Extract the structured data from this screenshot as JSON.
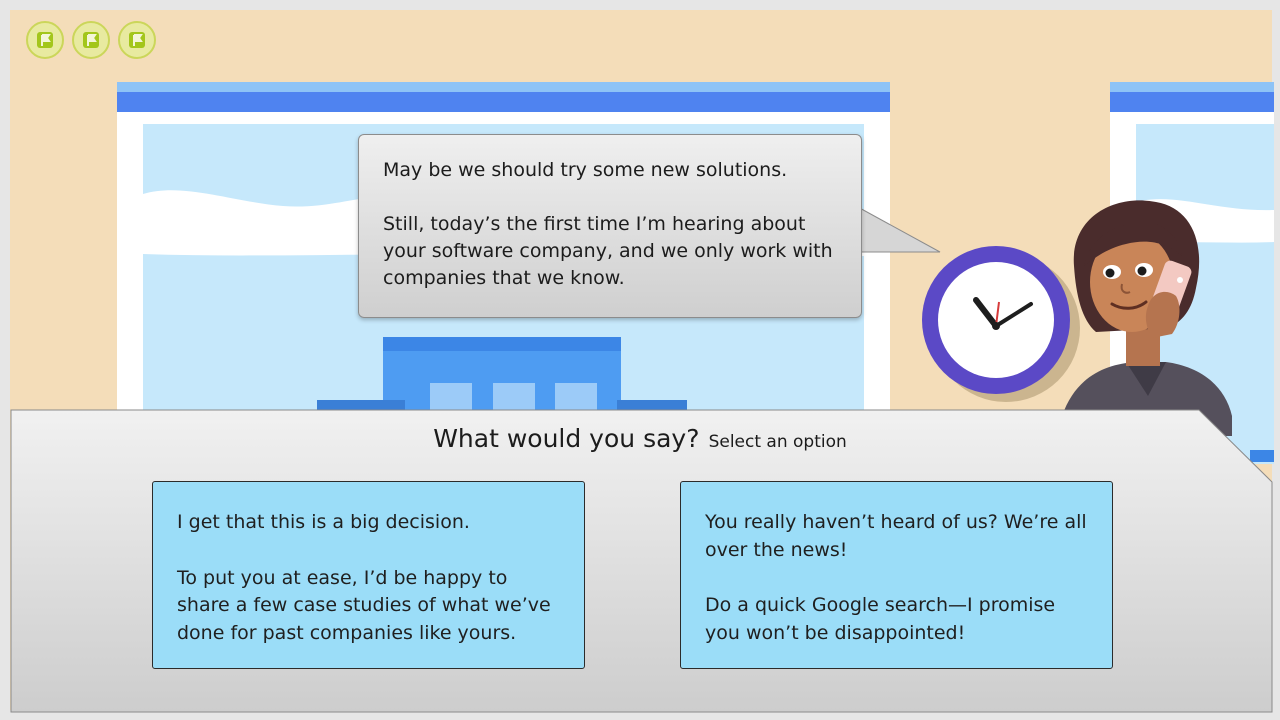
{
  "nav": {
    "flag_buttons": [
      "flag-icon",
      "flag-icon",
      "flag-icon"
    ]
  },
  "dialogue": {
    "speech_line_1": "May be we should try some new solutions.",
    "speech_line_2": "Still, today’s the first time I’m hearing about your software company, and we only work with companies that we know."
  },
  "question": {
    "title": "What would you say?",
    "instruction": "Select an option"
  },
  "options": [
    {
      "line_1": "I get that this is a big decision.",
      "line_2": "To put you at ease, I’d be happy to share a few case studies of what we’ve done for past companies like yours."
    },
    {
      "line_1": "You really haven’t heard of us? We’re all over the news!",
      "line_2": "Do a quick Google search—I promise you won’t be disappointed!"
    }
  ],
  "colors": {
    "wall": "#f4ddb9",
    "window_bar": "#4f83f0",
    "glass": "#c6e8fb",
    "option_fill": "#9bddf8",
    "clock_rim": "#5b49c6",
    "flag_green": "#a3c61b"
  }
}
